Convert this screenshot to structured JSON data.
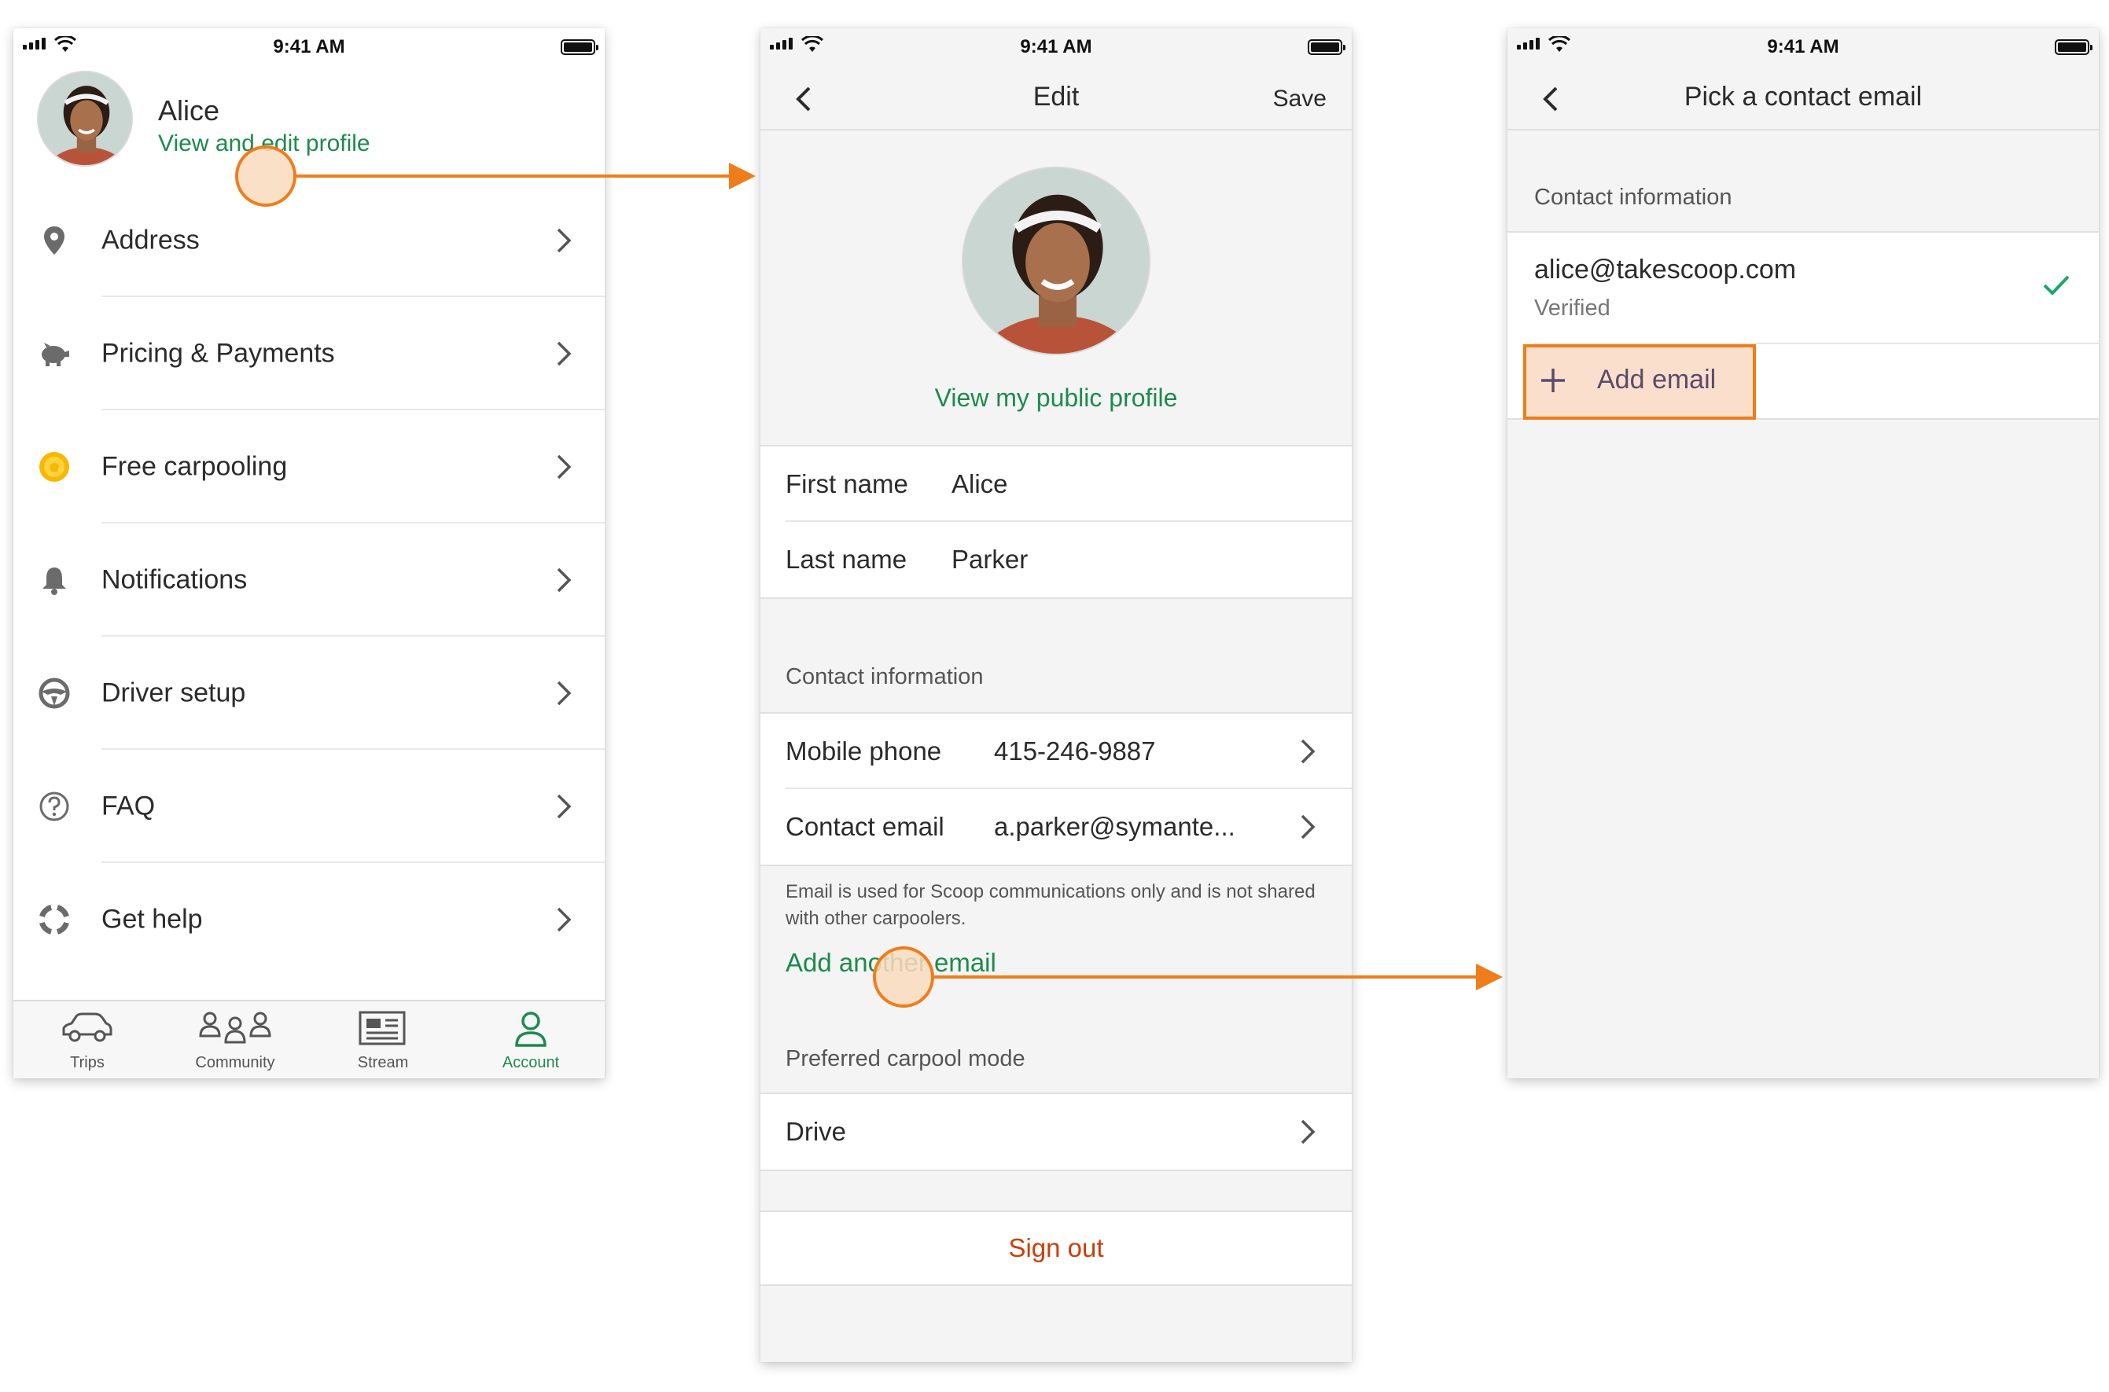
{
  "status_bar": {
    "time": "9:41 AM"
  },
  "screen1": {
    "profile": {
      "name": "Alice",
      "edit_link": "View and edit profile"
    },
    "menu": [
      {
        "label": "Address",
        "icon": "location-pin-icon"
      },
      {
        "label": "Pricing & Payments",
        "icon": "piggy-bank-icon"
      },
      {
        "label": "Free carpooling",
        "icon": "gold-coin-icon"
      },
      {
        "label": "Notifications",
        "icon": "bell-icon"
      },
      {
        "label": "Driver setup",
        "icon": "steering-wheel-icon"
      },
      {
        "label": "FAQ",
        "icon": "question-circle-icon"
      },
      {
        "label": "Get help",
        "icon": "lifebuoy-icon"
      }
    ],
    "tabs": [
      {
        "label": "Trips",
        "icon": "car-icon"
      },
      {
        "label": "Community",
        "icon": "people-icon"
      },
      {
        "label": "Stream",
        "icon": "newspaper-icon"
      },
      {
        "label": "Account",
        "icon": "person-icon",
        "active": true
      }
    ]
  },
  "screen2": {
    "nav": {
      "title": "Edit",
      "save": "Save"
    },
    "public_profile_link": "View my public profile",
    "first_name_label": "First name",
    "first_name_value": "Alice",
    "last_name_label": "Last name",
    "last_name_value": "Parker",
    "contact_header": "Contact information",
    "mobile_label": "Mobile phone",
    "mobile_value": "415-246-9887",
    "email_label": "Contact email",
    "email_value": "a.parker@symante...",
    "email_note": "Email is used for Scoop communications only and is not shared with other carpoolers.",
    "add_another_email": "Add another email",
    "preferred_mode_header": "Preferred carpool mode",
    "preferred_mode_value": "Drive",
    "sign_out": "Sign out"
  },
  "screen3": {
    "nav": {
      "title": "Pick a contact email"
    },
    "contact_header": "Contact information",
    "email": "alice@takescoop.com",
    "email_status": "Verified",
    "add_email": "Add email"
  },
  "colors": {
    "brand_green": "#1e8a4d",
    "annotation_orange": "#ef7d1b",
    "sign_out_red": "#cc3d0a"
  }
}
